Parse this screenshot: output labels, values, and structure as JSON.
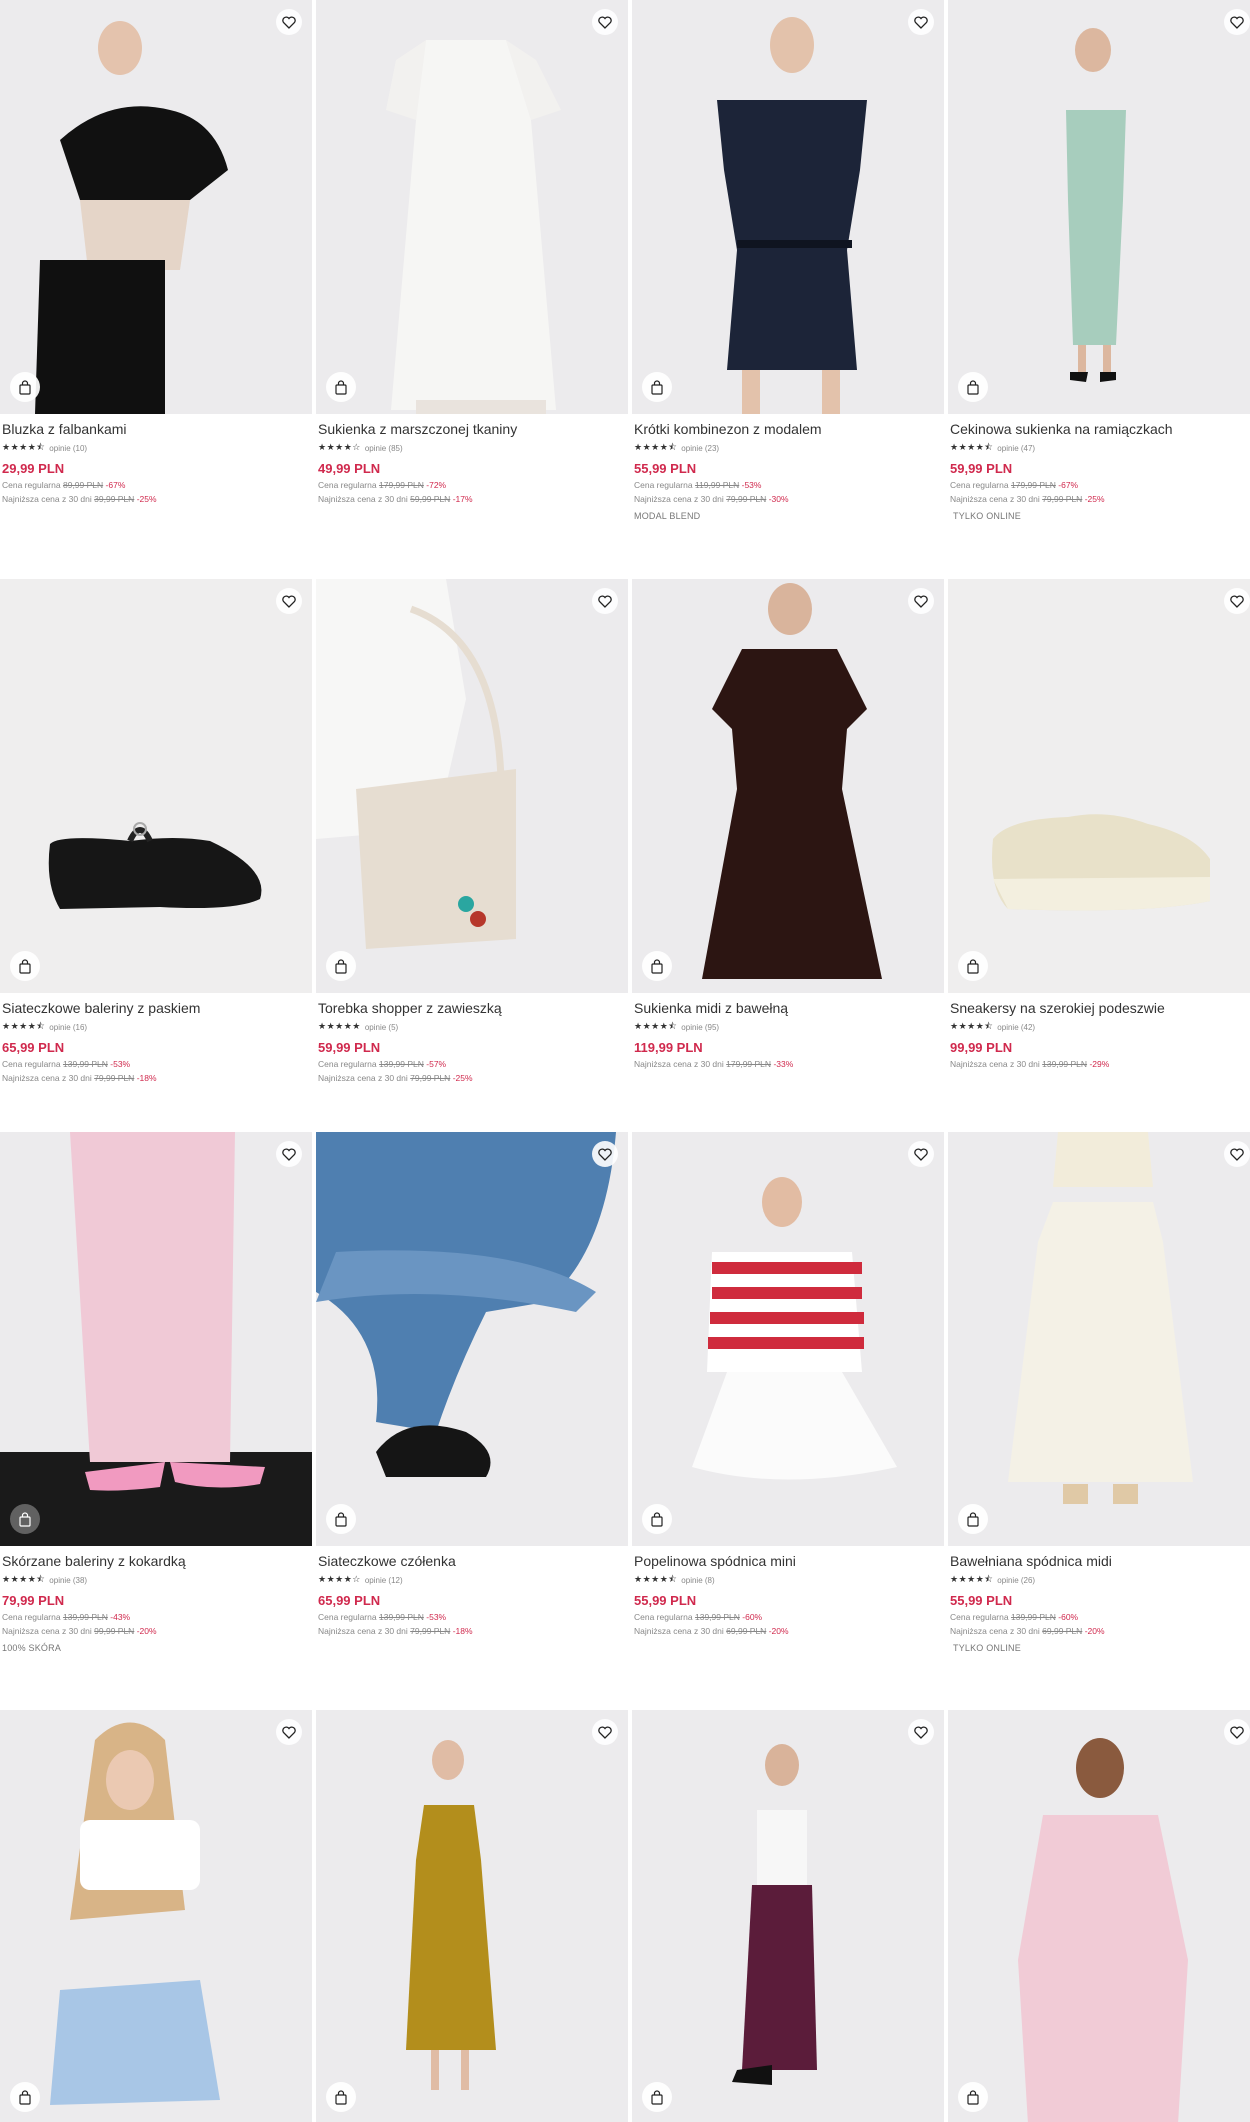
{
  "products": [
    {
      "name": "Bluzka z falbankami",
      "stars": "★★★★⯪",
      "reviews": "opinie (10)",
      "price": "29,99 PLN",
      "regular_label": "Cena regularna",
      "regular_price": "89,99 PLN",
      "regular_pct": "-67%",
      "lowest_label": "Najniższa cena z 30 dni",
      "lowest_price": "39,99 PLN",
      "lowest_pct": "-25%",
      "tag": ""
    },
    {
      "name": "Sukienka z marszczonej tkaniny",
      "stars": "★★★★☆",
      "reviews": "opinie (85)",
      "price": "49,99 PLN",
      "regular_label": "Cena regularna",
      "regular_price": "179,99 PLN",
      "regular_pct": "-72%",
      "lowest_label": "Najniższa cena z 30 dni",
      "lowest_price": "59,99 PLN",
      "lowest_pct": "-17%",
      "tag": ""
    },
    {
      "name": "Krótki kombinezon z modalem",
      "stars": "★★★★⯪",
      "reviews": "opinie (23)",
      "price": "55,99 PLN",
      "regular_label": "Cena regularna",
      "regular_price": "119,99 PLN",
      "regular_pct": "-53%",
      "lowest_label": "Najniższa cena z 30 dni",
      "lowest_price": "79,99 PLN",
      "lowest_pct": "-30%",
      "tag": "MODAL BLEND"
    },
    {
      "name": "Cekinowa sukienka na ramiączkach",
      "stars": "★★★★⯪",
      "reviews": "opinie (47)",
      "price": "59,99 PLN",
      "regular_label": "Cena regularna",
      "regular_price": "179,99 PLN",
      "regular_pct": "-67%",
      "lowest_label": "Najniższa cena z 30 dni",
      "lowest_price": "79,99 PLN",
      "lowest_pct": "-25%",
      "tag": "TYLKO ONLINE"
    },
    {
      "name": "Siateczkowe baleriny z paskiem",
      "stars": "★★★★⯪",
      "reviews": "opinie (16)",
      "price": "65,99 PLN",
      "regular_label": "Cena regularna",
      "regular_price": "139,99 PLN",
      "regular_pct": "-53%",
      "lowest_label": "Najniższa cena z 30 dni",
      "lowest_price": "79,99 PLN",
      "lowest_pct": "-18%",
      "tag": ""
    },
    {
      "name": "Torebka shopper z zawieszką",
      "stars": "★★★★★",
      "reviews": "opinie (5)",
      "price": "59,99 PLN",
      "regular_label": "Cena regularna",
      "regular_price": "139,99 PLN",
      "regular_pct": "-57%",
      "lowest_label": "Najniższa cena z 30 dni",
      "lowest_price": "79,99 PLN",
      "lowest_pct": "-25%",
      "tag": ""
    },
    {
      "name": "Sukienka midi z bawełną",
      "stars": "★★★★⯪",
      "reviews": "opinie (95)",
      "price": "119,99 PLN",
      "regular_label": "",
      "regular_price": "",
      "regular_pct": "",
      "lowest_label": "Najniższa cena z 30 dni",
      "lowest_price": "179,99 PLN",
      "lowest_pct": "-33%",
      "tag": ""
    },
    {
      "name": "Sneakersy na szerokiej podeszwie",
      "stars": "★★★★⯪",
      "reviews": "opinie (42)",
      "price": "99,99 PLN",
      "regular_label": "",
      "regular_price": "",
      "regular_pct": "",
      "lowest_label": "Najniższa cena z 30 dni",
      "lowest_price": "139,99 PLN",
      "lowest_pct": "-29%",
      "tag": ""
    },
    {
      "name": "Skórzane baleriny z kokardką",
      "stars": "★★★★⯪",
      "reviews": "opinie (38)",
      "price": "79,99 PLN",
      "regular_label": "Cena regularna",
      "regular_price": "139,99 PLN",
      "regular_pct": "-43%",
      "lowest_label": "Najniższa cena z 30 dni",
      "lowest_price": "99,99 PLN",
      "lowest_pct": "-20%",
      "tag": "100% SKÓRA"
    },
    {
      "name": "Siateczkowe czółenka",
      "stars": "★★★★☆",
      "reviews": "opinie (12)",
      "price": "65,99 PLN",
      "regular_label": "Cena regularna",
      "regular_price": "139,99 PLN",
      "regular_pct": "-53%",
      "lowest_label": "Najniższa cena z 30 dni",
      "lowest_price": "79,99 PLN",
      "lowest_pct": "-18%",
      "tag": ""
    },
    {
      "name": "Popelinowa spódnica mini",
      "stars": "★★★★⯪",
      "reviews": "opinie (8)",
      "price": "55,99 PLN",
      "regular_label": "Cena regularna",
      "regular_price": "139,99 PLN",
      "regular_pct": "-60%",
      "lowest_label": "Najniższa cena z 30 dni",
      "lowest_price": "69,99 PLN",
      "lowest_pct": "-20%",
      "tag": ""
    },
    {
      "name": "Bawełniana spódnica midi",
      "stars": "★★★★⯪",
      "reviews": "opinie (26)",
      "price": "55,99 PLN",
      "regular_label": "Cena regularna",
      "regular_price": "139,99 PLN",
      "regular_pct": "-60%",
      "lowest_label": "Najniższa cena z 30 dni",
      "lowest_price": "69,99 PLN",
      "lowest_pct": "-20%",
      "tag": "TYLKO ONLINE"
    },
    {
      "name": "",
      "stars": "",
      "reviews": "",
      "price": "",
      "regular_label": "",
      "regular_price": "",
      "regular_pct": "",
      "lowest_label": "",
      "lowest_price": "",
      "lowest_pct": "",
      "tag": ""
    },
    {
      "name": "",
      "stars": "",
      "reviews": "",
      "price": "",
      "regular_label": "",
      "regular_price": "",
      "regular_pct": "",
      "lowest_label": "",
      "lowest_price": "",
      "lowest_pct": "",
      "tag": ""
    },
    {
      "name": "",
      "stars": "",
      "reviews": "",
      "price": "",
      "regular_label": "",
      "regular_price": "",
      "regular_pct": "",
      "lowest_label": "",
      "lowest_price": "",
      "lowest_pct": "",
      "tag": ""
    },
    {
      "name": "",
      "stars": "",
      "reviews": "",
      "price": "",
      "regular_label": "",
      "regular_price": "",
      "regular_pct": "",
      "lowest_label": "",
      "lowest_price": "",
      "lowest_pct": "",
      "tag": ""
    }
  ],
  "icons": {
    "wishlist": "heart-icon",
    "add_to_bag": "shopping-bag-icon"
  },
  "colors": {
    "price": "#d0294d",
    "discount": "#d0294d",
    "text": "#333333",
    "muted": "#888888"
  }
}
